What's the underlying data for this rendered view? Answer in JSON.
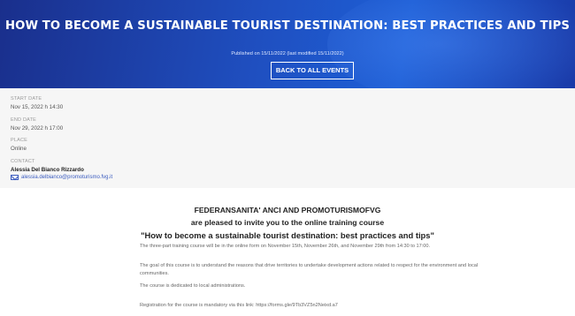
{
  "header": {
    "title": "HOW TO BECOME A SUSTAINABLE TOURIST DESTINATION: BEST PRACTICES AND TIPS",
    "published": "Published on 15/11/2022 (last modified 15/11/2022)",
    "back_label": "BACK TO ALL EVENTS"
  },
  "meta": {
    "start_label": "START DATE",
    "start_value": "Nov 15, 2022 h 14:30",
    "end_label": "END DATE",
    "end_value": "Nov 29, 2022 h 17:00",
    "place_label": "PLACE",
    "place_value": "Online",
    "contact_label": "CONTACT",
    "contact_name": "Alessia Del Bianco Rizzardo",
    "contact_email": "alessia.delbianco@promoturismo.fvg.it"
  },
  "body": {
    "heading1": "FEDERANSANITA' ANCI AND PROMOTURISMOFVG",
    "heading2": "are pleased to invite you to the online training course",
    "heading3": "\"How to become a sustainable tourist destination: best practices and tips\"",
    "para1": "The three-part training course will be in the online form on November 15th, November 26th, and November 29th from 14:30 to 17:00.",
    "para2": "The goal of this course is to understand the reasons that drive territories to undertake development actions related to respect for the environment and local communities.",
    "para3": "The course is dedicated to local administrations.",
    "para4": "Registration for the course is mandatory via this link: https://forms.gle/9Tb3VZ5n2Neixd.a7"
  }
}
